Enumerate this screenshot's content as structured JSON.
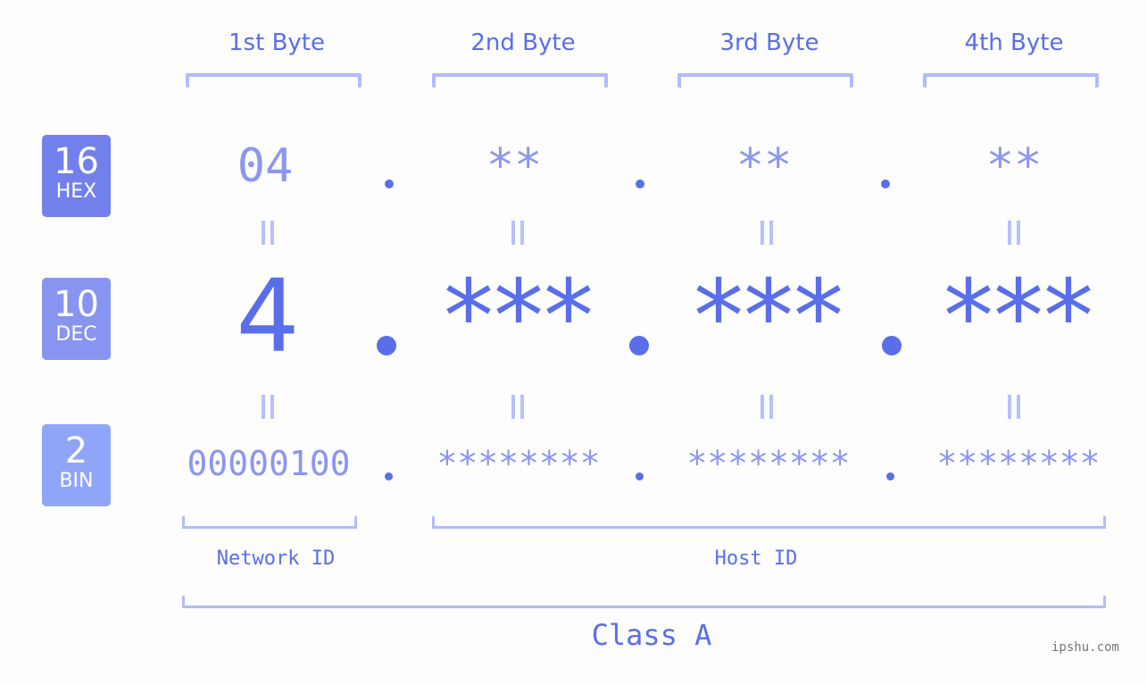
{
  "bytes_header": [
    "1st Byte",
    "2nd Byte",
    "3rd Byte",
    "4th Byte"
  ],
  "bases": [
    {
      "number": "16",
      "label": "HEX",
      "color": "#7280EB"
    },
    {
      "number": "10",
      "label": "DEC",
      "color": "#8794F0"
    },
    {
      "number": "2",
      "label": "BIN",
      "color": "#8FA6F8"
    }
  ],
  "hex": [
    "04",
    "**",
    "**",
    "**"
  ],
  "dec": [
    "4",
    "***",
    "***",
    "***"
  ],
  "bin": [
    "00000100",
    "********",
    "********",
    "********"
  ],
  "network_id_label": "Network ID",
  "host_id_label": "Host ID",
  "class_label": "Class A",
  "watermark": "ipshu.com",
  "colors": {
    "text": "#5A6EEA",
    "value_light": "#8B96F0",
    "bracket": "#B3BCF8",
    "background": "#FCFDFC"
  }
}
